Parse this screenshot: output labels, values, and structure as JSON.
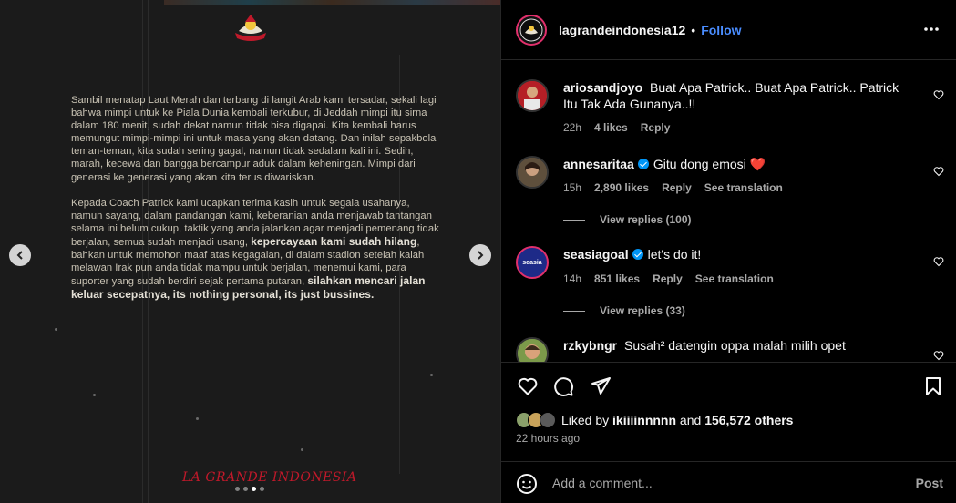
{
  "post": {
    "paragraph1": "Sambil menatap Laut Merah dan terbang di langit Arab kami tersadar, sekali lagi bahwa mimpi untuk ke Piala Dunia kembali terkubur, di Jeddah mimpi itu sirna dalam 180 menit, sudah dekat namun tidak bisa digapai. Kita kembali harus memungut mimpi-mimpi ini untuk masa yang akan datang. Dan inilah sepakbola teman-teman, kita sudah sering gagal, namun tidak sedalam kali ini. Sedih, marah, kecewa dan bangga bercampur aduk dalam keheningan. Mimpi dari generasi ke generasi yang akan kita terus diwariskan.",
    "p2_a": "Kepada Coach Patrick kami ucapkan terima kasih untuk segala usahanya, namun sayang, dalam pandangan kami, keberanian anda menjawab tantangan selama ini belum cukup, taktik yang anda jalankan agar menjadi pemenang tidak berjalan, semua sudah menjadi usang, ",
    "p2_b": "kepercayaan kami sudah hilang",
    "p2_c": ", bahkan untuk memohon maaf atas kegagalan, di dalam stadion setelah kalah melawan Irak pun anda tidak mampu untuk berjalan, menemui kami, para suporter yang sudah berdiri sejak pertama putaran, ",
    "p2_d": "silahkan mencari jalan keluar secepatnya, its nothing personal, its just bussines.",
    "brand": "LA GRANDE INDONESIA",
    "slides": 4,
    "active_slide": 3
  },
  "header": {
    "username": "lagrandeindonesia12",
    "separator": "•",
    "follow": "Follow"
  },
  "comments": [
    {
      "user": "ariosandjoyo",
      "text": "Buat Apa Patrick.. Buat Apa Patrick.. Patrick Itu Tak Ada Gunanya..!!",
      "verified": false,
      "time": "22h",
      "likes": "4 likes",
      "reply": "Reply"
    },
    {
      "user": "annesaritaa",
      "text": "Gitu dong emosi ❤️",
      "verified": true,
      "time": "15h",
      "likes": "2,890 likes",
      "reply": "Reply",
      "translate": "See translation",
      "view_replies": "View replies (100)"
    },
    {
      "user": "seasiagoal",
      "text": "let's do it!",
      "verified": true,
      "time": "14h",
      "likes": "851 likes",
      "reply": "Reply",
      "translate": "See translation",
      "view_replies": "View replies (33)",
      "avatar_text": "seasia"
    },
    {
      "user": "rzkybngr",
      "text": "Susah² datengin oppa malah milih opet",
      "verified": false
    }
  ],
  "likes": {
    "prefix": "Liked by ",
    "user": "ikiiiinnnnn",
    "middle": " and ",
    "count": "156,572 others"
  },
  "time_ago": "22 hours ago",
  "add_comment": {
    "placeholder": "Add a comment...",
    "post_label": "Post"
  },
  "colors": {
    "accent": "#4a8dff",
    "verified": "#0095f6",
    "brand_red": "#c0192a"
  }
}
